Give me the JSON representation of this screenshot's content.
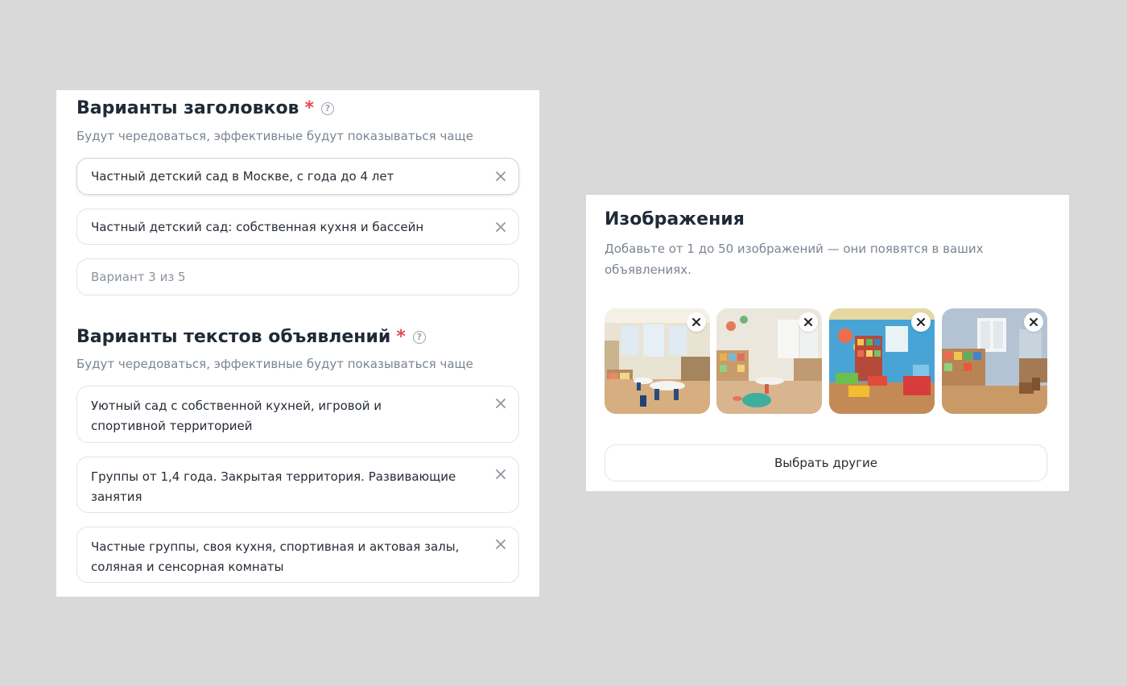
{
  "headlines": {
    "title": "Варианты заголовков",
    "required_mark": "*",
    "help_symbol": "?",
    "hint": "Будут чередоваться, эффективные будут показываться чаще",
    "fields": [
      {
        "value": "Частный детский сад в Москве, с года до 4 лет"
      },
      {
        "value": "Частный детский сад: собственная кухня и бассейн"
      }
    ],
    "empty_field": {
      "placeholder": "Вариант 3 из 5"
    }
  },
  "texts": {
    "title": "Варианты текстов объявлений",
    "required_mark": "*",
    "help_symbol": "?",
    "hint": "Будут чередоваться, эффективные будут показываться чаще",
    "fields": [
      {
        "line1": "Уютный сад с собственной кухней, игровой и",
        "line2": "спортивной территорией"
      },
      {
        "line1": "Группы от 1,4 года. Закрытая территория. Развивающие",
        "line2": "занятия"
      },
      {
        "line1": "Частные группы, своя кухня, спортивная и актовая залы,",
        "line2": "соляная и сенсорная комнаты"
      }
    ]
  },
  "images": {
    "title": "Изображения",
    "hint_line1": "Добавьте от 1 до 50 изображений — они появятся в ваших",
    "hint_line2": "объявлениях.",
    "choose_button": "Выбрать другие"
  },
  "icons": {
    "help": "question-circle-icon",
    "clear": "close-icon",
    "remove": "close-icon"
  },
  "colors": {
    "required": "#e5484d",
    "hint_text": "#7b8591",
    "field_border": "#dfe3e8",
    "page_background": "#d9d9d9"
  }
}
